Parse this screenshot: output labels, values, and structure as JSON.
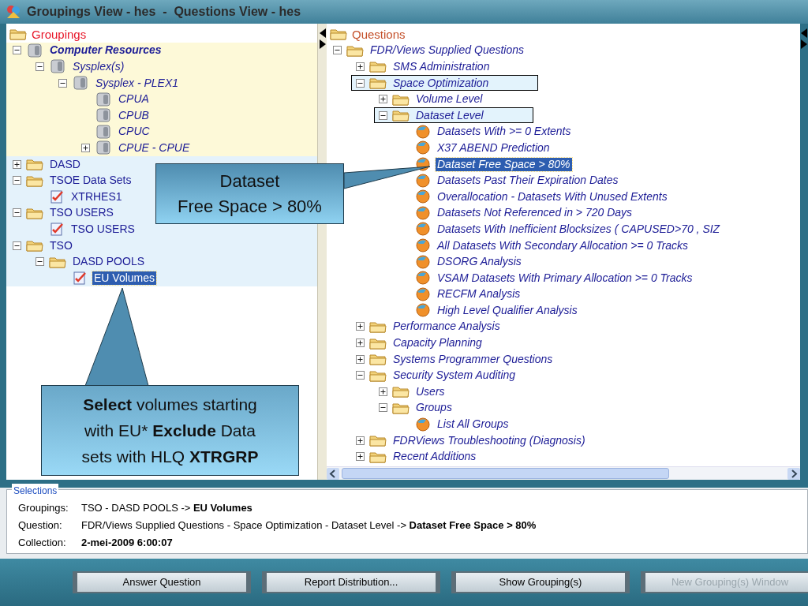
{
  "window": {
    "title": "Groupings View - hes  -  Questions View - hes"
  },
  "groupings_tree": {
    "root": "Groupings",
    "children": [
      {
        "label": "Computer Resources",
        "kind": "server",
        "bold": true,
        "selected": false,
        "expanded": true,
        "color": "#fdf9d8",
        "children": [
          {
            "label": "Sysplex(s)",
            "kind": "server",
            "selected": false,
            "expanded": true,
            "children": [
              {
                "label": "Sysplex - PLEX1",
                "kind": "server",
                "selected": false,
                "expanded": true,
                "children": [
                  {
                    "label": "CPUA",
                    "kind": "server",
                    "selected": false
                  },
                  {
                    "label": "CPUB",
                    "kind": "server",
                    "selected": false
                  },
                  {
                    "label": "CPUC",
                    "kind": "server",
                    "selected": false
                  },
                  {
                    "label": "CPUE - CPUE",
                    "kind": "server",
                    "selected": false,
                    "expanded": false
                  }
                ]
              }
            ]
          }
        ]
      },
      {
        "label": "DASD",
        "kind": "folder",
        "selected": false,
        "expanded": false,
        "color": "#e4f2fb"
      },
      {
        "label": "TSOE Data Sets",
        "kind": "folder",
        "selected": false,
        "expanded": true,
        "color": "#e4f2fb",
        "children": [
          {
            "label": "XTRHES1",
            "kind": "report",
            "selected": false
          }
        ]
      },
      {
        "label": "TSO USERS",
        "kind": "folder",
        "selected": false,
        "expanded": true,
        "color": "#e4f2fb",
        "children": [
          {
            "label": "TSO USERS",
            "kind": "report",
            "selected": false
          }
        ]
      },
      {
        "label": "TSO",
        "kind": "folder",
        "selected": false,
        "expanded": true,
        "color": "#e4f2fb",
        "children": [
          {
            "label": "DASD POOLS",
            "kind": "folder",
            "selected": false,
            "expanded": true,
            "children": [
              {
                "label": "EU Volumes",
                "kind": "report",
                "selected": true
              }
            ]
          }
        ]
      }
    ]
  },
  "questions_tree": {
    "root": "Questions",
    "children": [
      {
        "label": "FDR/Views Supplied Questions",
        "kind": "folder",
        "selected": false,
        "expanded": true,
        "children": [
          {
            "label": "SMS Administration",
            "kind": "folder",
            "selected": false,
            "expanded": false
          },
          {
            "label": "Space Optimization",
            "kind": "folder",
            "selected": false,
            "expanded": true,
            "boxed": true,
            "children": [
              {
                "label": "Volume Level",
                "kind": "folder",
                "selected": false,
                "expanded": false
              },
              {
                "label": "Dataset Level",
                "kind": "folder",
                "selected": false,
                "expanded": true,
                "boxed": true,
                "children": [
                  {
                    "label": "Datasets With >= 0 Extents",
                    "kind": "question",
                    "selected": false
                  },
                  {
                    "label": "X37 ABEND Prediction",
                    "kind": "question",
                    "selected": false
                  },
                  {
                    "label": "Dataset Free Space > 80%",
                    "kind": "question",
                    "selected": true
                  },
                  {
                    "label": "Datasets Past Their Expiration Dates",
                    "kind": "question",
                    "selected": false
                  },
                  {
                    "label": "Overallocation - Datasets With Unused Extents",
                    "kind": "question",
                    "selected": false
                  },
                  {
                    "label": "Datasets Not Referenced in > 720 Days",
                    "kind": "question",
                    "selected": false
                  },
                  {
                    "label": "Datasets With Inefficient Blocksizes ( CAPUSED>70 , SIZ",
                    "kind": "question",
                    "selected": false
                  },
                  {
                    "label": "All Datasets With Secondary Allocation >= 0 Tracks",
                    "kind": "question",
                    "selected": false
                  },
                  {
                    "label": "DSORG Analysis",
                    "kind": "question",
                    "selected": false
                  },
                  {
                    "label": "VSAM Datasets With Primary Allocation >= 0 Tracks",
                    "kind": "question",
                    "selected": false
                  },
                  {
                    "label": "RECFM Analysis",
                    "kind": "question",
                    "selected": false
                  },
                  {
                    "label": "High Level Qualifier Analysis",
                    "kind": "question",
                    "selected": false
                  }
                ]
              }
            ]
          },
          {
            "label": "Performance Analysis",
            "kind": "folder",
            "selected": false,
            "expanded": false
          },
          {
            "label": "Capacity Planning",
            "kind": "folder",
            "selected": false,
            "expanded": false
          },
          {
            "label": "Systems Programmer Questions",
            "kind": "folder",
            "selected": false,
            "expanded": false
          },
          {
            "label": "Security System Auditing",
            "kind": "folder",
            "selected": false,
            "expanded": true,
            "children": [
              {
                "label": "Users",
                "kind": "folder",
                "selected": false,
                "expanded": false
              },
              {
                "label": "Groups",
                "kind": "folder",
                "selected": false,
                "expanded": true,
                "children": [
                  {
                    "label": "List All Groups",
                    "kind": "question",
                    "selected": false
                  }
                ]
              }
            ]
          },
          {
            "label": "FDRViews Troubleshooting (Diagnosis)",
            "kind": "folder",
            "selected": false,
            "expanded": false
          },
          {
            "label": "Recent Additions",
            "kind": "folder",
            "selected": false,
            "expanded": false
          }
        ]
      }
    ]
  },
  "selections": {
    "legend": "Selections",
    "rows": [
      {
        "label": "Groupings:",
        "value": "TSO - DASD POOLS -> **EU Volumes**",
        "strong": false
      },
      {
        "label": "Question:",
        "value": "FDR/Views Supplied Questions - Space Optimization - Dataset Level -> **Dataset Free Space > 80%**",
        "strong": false
      },
      {
        "label": "Collection:",
        "value": "2-mei-2009 6:00:07",
        "strong": true
      }
    ]
  },
  "buttons": [
    {
      "label": "Answer Question",
      "disabled": false
    },
    {
      "label": "Report Distribution...",
      "disabled": false
    },
    {
      "label": "Show Grouping(s)",
      "disabled": false
    },
    {
      "label": "New Grouping(s) Window",
      "disabled": true
    }
  ],
  "callouts": [
    {
      "kind": "side",
      "text": "Dataset\nFree Space > 80%"
    },
    {
      "kind": "up",
      "text": "**Select** volumes starting with EU* **Exclude** Data sets with HLQ **XTRGRP**"
    }
  ]
}
